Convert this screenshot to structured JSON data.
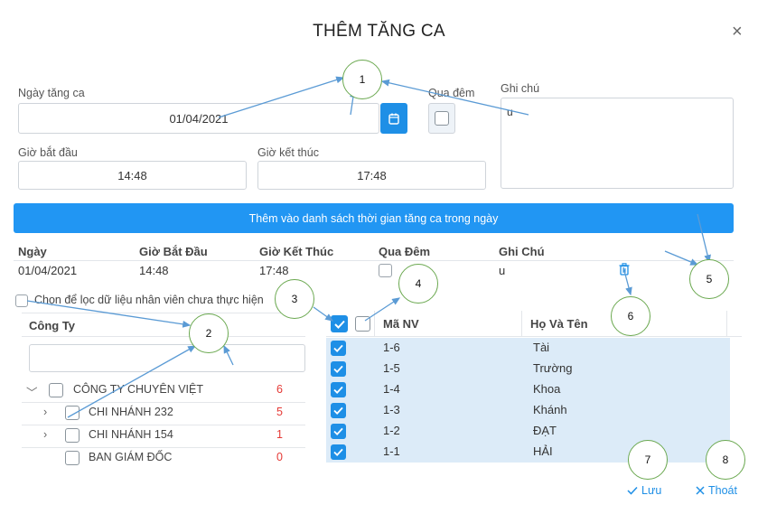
{
  "dialog": {
    "title": "THÊM TĂNG CA",
    "close_glyph": "×"
  },
  "form": {
    "date_label": "Ngày tăng ca",
    "date_value": "01/04/2021",
    "overnight_label": "Qua đêm",
    "note_label": "Ghi chú",
    "note_value": "u",
    "start_label": "Giờ bắt đầu",
    "start_value": "14:48",
    "end_label": "Giờ kết thúc",
    "end_value": "17:48"
  },
  "add_bar_label": "Thêm vào danh sách thời gian tăng ca trong ngày",
  "schedule": {
    "headers": [
      "Ngày",
      "Giờ Bắt Đầu",
      "Giờ Kết Thúc",
      "Qua Đêm",
      "Ghi Chú"
    ],
    "rows": [
      {
        "date": "01/04/2021",
        "start": "14:48",
        "end": "17:48",
        "overnight": false,
        "note": "u",
        "delete_icon": "trash-icon"
      }
    ]
  },
  "filter_label": "Chọn để lọc dữ liệu nhân viên chưa thực hiện",
  "company_panel": {
    "header": "Công Ty",
    "search_value": "",
    "tree": [
      {
        "label": "CÔNG TY CHUYÊN VIỆT",
        "count": "6",
        "expander": "chevron-down"
      },
      {
        "label": "CHI NHÁNH 232",
        "count": "5",
        "expander": "chevron-right"
      },
      {
        "label": "CHI NHÁNH 154",
        "count": "1",
        "expander": "chevron-right"
      },
      {
        "label": "BAN GIÁM ĐỐC",
        "count": "0",
        "expander": ""
      }
    ]
  },
  "employees": {
    "headers": {
      "code": "Mã NV",
      "name": "Họ Và Tên"
    },
    "rows": [
      {
        "code": "1-6",
        "name": "Tài",
        "checked": true
      },
      {
        "code": "1-5",
        "name": "Trường",
        "checked": true
      },
      {
        "code": "1-4",
        "name": "Khoa",
        "checked": true
      },
      {
        "code": "1-3",
        "name": "Khánh",
        "checked": true
      },
      {
        "code": "1-2",
        "name": "ĐẠT",
        "checked": true
      },
      {
        "code": "1-1",
        "name": "HẢI",
        "checked": true
      }
    ]
  },
  "actions": {
    "save_label": "Lưu",
    "exit_label": "Thoát"
  },
  "annotations": [
    "1",
    "2",
    "3",
    "4",
    "5",
    "6",
    "7",
    "8"
  ],
  "colors": {
    "accent": "#2196f3",
    "row_selected": "#dcebf8",
    "count_red": "#e53935",
    "annotation_circle": "#6aa84f",
    "annotation_arrow": "#5b9bd5"
  }
}
